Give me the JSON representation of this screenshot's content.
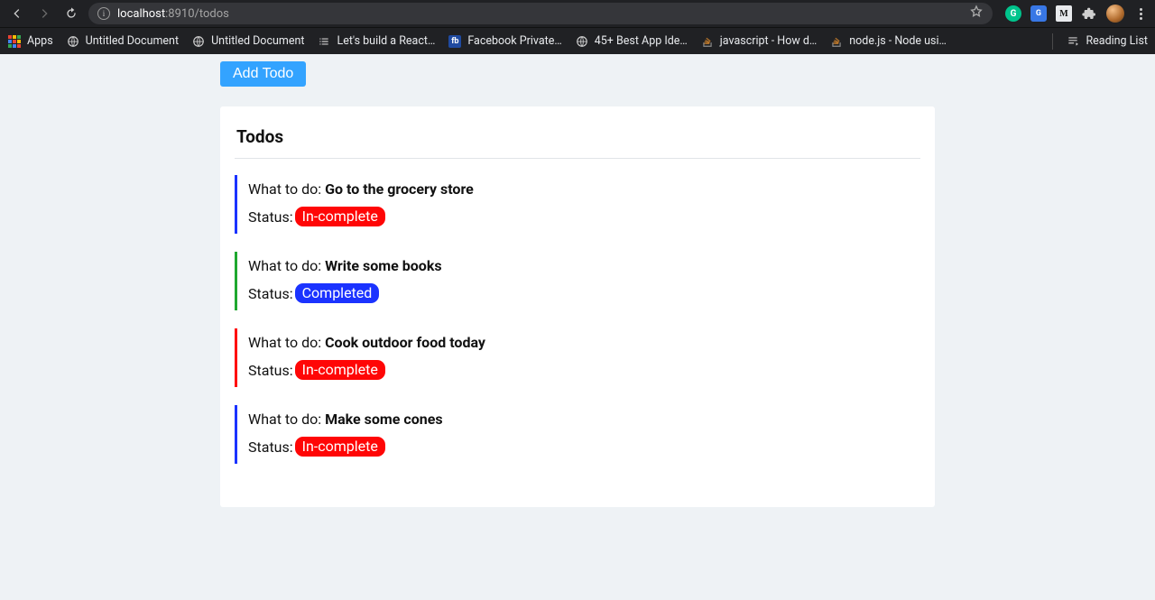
{
  "browser": {
    "url_host": "localhost",
    "url_port": ":8910",
    "url_path": "/todos",
    "bookmarks": {
      "apps": "Apps",
      "items": [
        {
          "label": "Untitled Document",
          "icon": "globe"
        },
        {
          "label": "Untitled Document",
          "icon": "globe"
        },
        {
          "label": "Let's build a React…",
          "icon": "list"
        },
        {
          "label": "Facebook Private…",
          "icon": "fb"
        },
        {
          "label": "45+ Best App Ide…",
          "icon": "globe"
        },
        {
          "label": "javascript - How d…",
          "icon": "so"
        },
        {
          "label": "node.js - Node usi…",
          "icon": "so"
        }
      ],
      "reading_list": "Reading List"
    }
  },
  "page": {
    "add_button": "Add Todo",
    "heading": "Todos",
    "what_label": "What to do: ",
    "status_label": "Status:",
    "status_incomplete": "In-complete",
    "status_complete": "Completed",
    "todos": [
      {
        "title": "Go to the grocery store",
        "status": "incomplete",
        "border": "blue"
      },
      {
        "title": "Write some books",
        "status": "complete",
        "border": "green"
      },
      {
        "title": "Cook outdoor food today",
        "status": "incomplete",
        "border": "red"
      },
      {
        "title": "Make some cones",
        "status": "incomplete",
        "border": "blue"
      }
    ]
  }
}
